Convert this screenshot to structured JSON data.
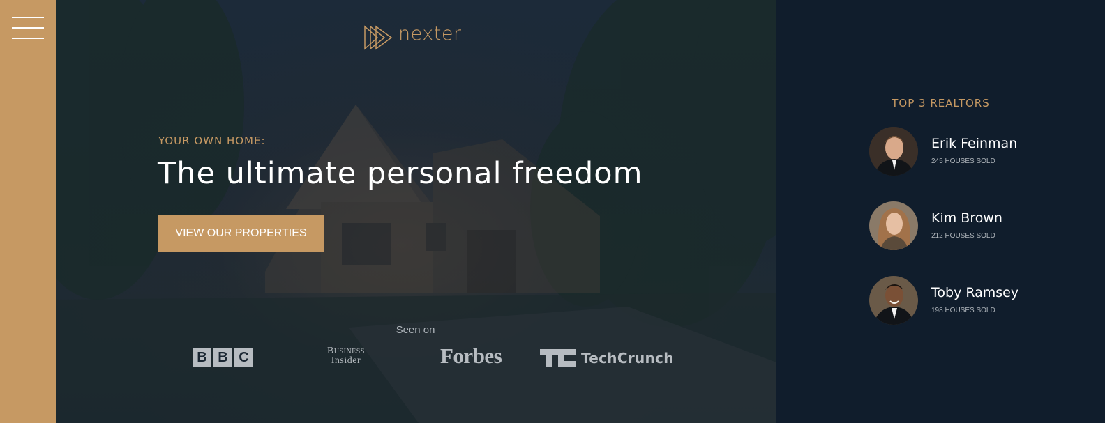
{
  "nav": {
    "menu_icon": "hamburger-menu-icon"
  },
  "brand": {
    "logo_icon": "triple-play-triangle-icon",
    "name": "nexter"
  },
  "hero": {
    "sub_heading": "YOUR OWN HOME:",
    "heading": "The ultimate personal freedom",
    "cta_label": "VIEW OUR PROPERTIES"
  },
  "press": {
    "seen_on_label": "Seen on",
    "bbc": [
      "B",
      "B",
      "C"
    ],
    "business_insider": [
      "Business",
      "Insider"
    ],
    "forbes": "Forbes",
    "techcrunch": "TechCrunch"
  },
  "realtors": {
    "title": "TOP 3 REALTORS",
    "items": [
      {
        "name": "Erik Feinman",
        "sold": "245 HOUSES SOLD"
      },
      {
        "name": "Kim Brown",
        "sold": "212 HOUSES SOLD"
      },
      {
        "name": "Toby Ramsey",
        "sold": "198 HOUSES SOLD"
      }
    ]
  },
  "colors": {
    "accent": "#c69963",
    "dark_bg": "#101d2c",
    "white": "#ffffff",
    "muted": "#aeb4ba"
  }
}
